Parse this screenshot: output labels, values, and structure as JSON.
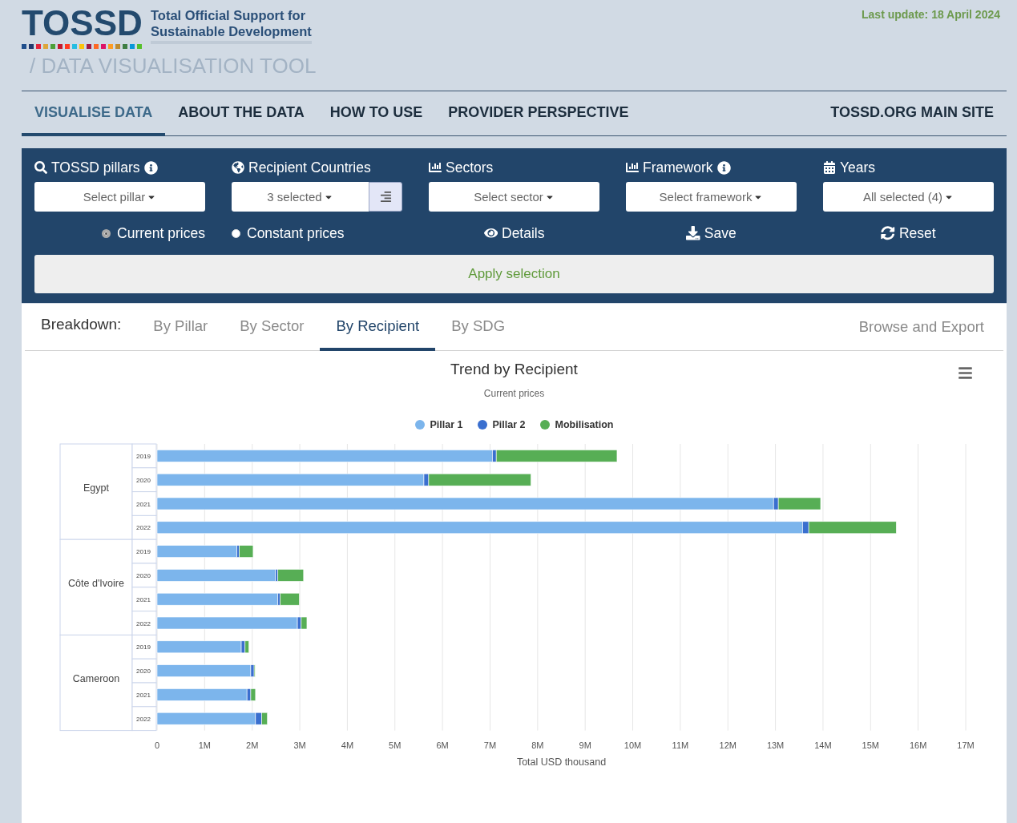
{
  "header": {
    "logo": "TOSSD",
    "tagline": [
      "Total Official Support for",
      "Sustainable Development"
    ],
    "subtitle": "/ DATA VISUALISATION TOOL",
    "last_update": "Last update: 18 April 2024"
  },
  "nav": [
    {
      "label": "VISUALISE DATA",
      "selected": true
    },
    {
      "label": "ABOUT THE DATA",
      "selected": false
    },
    {
      "label": "HOW TO USE",
      "selected": false
    },
    {
      "label": "PROVIDER PERSPECTIVE",
      "selected": false
    },
    {
      "label": "TOSSD.ORG MAIN SITE",
      "selected": false
    }
  ],
  "filters": [
    {
      "label": "TOSSD pillars",
      "info": true,
      "value": "Select pillar",
      "sort_button": false
    },
    {
      "label": "Recipient Countries",
      "info": false,
      "value": "3 selected",
      "sort_button": true
    },
    {
      "label": "Sectors",
      "info": false,
      "value": "Select sector",
      "sort_button": false
    },
    {
      "label": "Framework",
      "info": true,
      "value": "Select framework",
      "sort_button": false
    },
    {
      "label": "Years",
      "info": false,
      "value": "All selected (4)",
      "sort_button": false
    }
  ],
  "price_options": [
    {
      "label": "Current prices",
      "selected": true
    },
    {
      "label": "Constant prices",
      "selected": false
    }
  ],
  "actions": [
    "Details",
    "Save",
    "Reset"
  ],
  "apply_button": "Apply selection",
  "breakdown": {
    "label": "Breakdown:",
    "tabs": [
      {
        "label": "By Pillar",
        "selected": false
      },
      {
        "label": "By Sector",
        "selected": false
      },
      {
        "label": "By Recipient",
        "selected": true
      },
      {
        "label": "By SDG",
        "selected": false
      }
    ],
    "export": "Browse and Export"
  },
  "chart": {
    "title": "Trend by Recipient",
    "subtitle": "Current prices",
    "recipient_groups": [
      "Egypt",
      "Côte d'Ivoire",
      "Cameroon"
    ],
    "chart_data": {
      "type": "bar",
      "orientation": "horizontal",
      "stacked": true,
      "grid": true,
      "xlabel": "Total USD thousand",
      "categories": [
        "2019",
        "2020",
        "2021",
        "2022",
        "2019",
        "2020",
        "2021",
        "2022",
        "2019",
        "2020",
        "2021",
        "2022"
      ],
      "series": [
        {
          "name": "Pillar 1",
          "color": "#7cb5ec",
          "values": [
            7050000,
            5610000,
            12960000,
            13570000,
            1680000,
            2490000,
            2540000,
            2950000,
            1770000,
            1970000,
            1890000,
            2070000
          ]
        },
        {
          "name": "Pillar 2",
          "color": "#3a6fcf",
          "values": [
            80000,
            100000,
            100000,
            130000,
            50000,
            50000,
            50000,
            80000,
            80000,
            70000,
            80000,
            130000
          ]
        },
        {
          "name": "Mobilisation",
          "color": "#57ae55",
          "values": [
            2540000,
            2150000,
            890000,
            1840000,
            290000,
            540000,
            400000,
            120000,
            80000,
            20000,
            100000,
            120000
          ]
        }
      ],
      "xlim": [
        0,
        17000000
      ],
      "xticks": [
        {
          "value": 0,
          "label": "0"
        },
        {
          "value": 1000000,
          "label": "1M"
        },
        {
          "value": 2000000,
          "label": "2M"
        },
        {
          "value": 3000000,
          "label": "3M"
        },
        {
          "value": 4000000,
          "label": "4M"
        },
        {
          "value": 5000000,
          "label": "5M"
        },
        {
          "value": 6000000,
          "label": "6M"
        },
        {
          "value": 7000000,
          "label": "7M"
        },
        {
          "value": 8000000,
          "label": "8M"
        },
        {
          "value": 9000000,
          "label": "9M"
        },
        {
          "value": 10000000,
          "label": "10M"
        },
        {
          "value": 11000000,
          "label": "11M"
        },
        {
          "value": 12000000,
          "label": "12M"
        },
        {
          "value": 13000000,
          "label": "13M"
        },
        {
          "value": 14000000,
          "label": "14M"
        },
        {
          "value": 15000000,
          "label": "15M"
        },
        {
          "value": 16000000,
          "label": "16M"
        },
        {
          "value": 17000000,
          "label": "17M"
        }
      ]
    }
  }
}
